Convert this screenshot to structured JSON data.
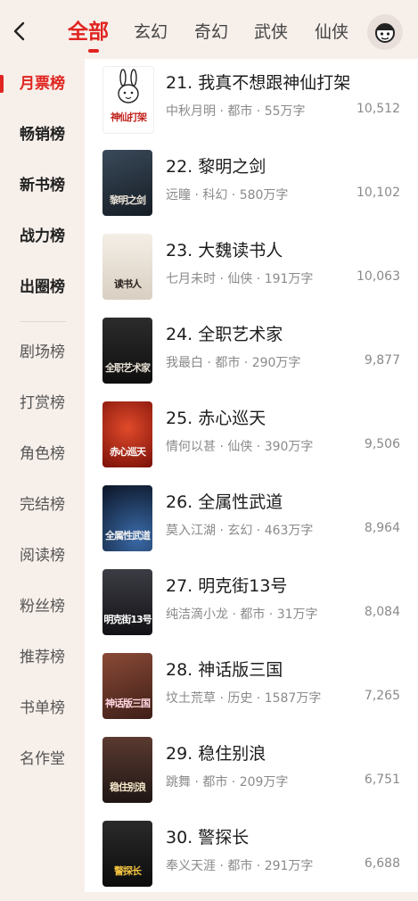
{
  "header": {
    "tabs": [
      {
        "label": "全部",
        "active": true
      },
      {
        "label": "玄幻",
        "active": false
      },
      {
        "label": "奇幻",
        "active": false
      },
      {
        "label": "武侠",
        "active": false
      },
      {
        "label": "仙侠",
        "active": false
      }
    ],
    "back_icon": "chevron-left-icon",
    "avatar_icon": "user-avatar-icon",
    "accent_color": "#e0241f"
  },
  "sidebar": {
    "items": [
      {
        "label": "月票榜",
        "active": true
      },
      {
        "label": "畅销榜"
      },
      {
        "label": "新书榜"
      },
      {
        "label": "战力榜"
      },
      {
        "label": "出圈榜"
      },
      {
        "label": "剧场榜"
      },
      {
        "label": "打赏榜"
      },
      {
        "label": "角色榜"
      },
      {
        "label": "完结榜"
      },
      {
        "label": "阅读榜"
      },
      {
        "label": "粉丝榜"
      },
      {
        "label": "推荐榜"
      },
      {
        "label": "书单榜"
      },
      {
        "label": "名作堂"
      }
    ]
  },
  "books": [
    {
      "title": "21. 我真不想跟神仙打架",
      "meta": "中秋月明 · 都市 · 55万字",
      "votes": "10,512",
      "cover_text": "神仙打架",
      "cover_color": "#ffffff",
      "cover_text_color": "#c0221b"
    },
    {
      "title": "22. 黎明之剑",
      "meta": "远瞳 · 科幻 · 580万字",
      "votes": "10,102",
      "cover_text": "黎明之剑",
      "cover_color": "#2b3440",
      "cover_text_color": "#e8e2d5"
    },
    {
      "title": "23. 大魏读书人",
      "meta": "七月未时 · 仙侠 · 191万字",
      "votes": "10,063",
      "cover_text": "读书人",
      "cover_color": "#efe9e0",
      "cover_text_color": "#2a2320"
    },
    {
      "title": "24. 全职艺术家",
      "meta": "我最白 · 都市 · 290万字",
      "votes": "9,877",
      "cover_text": "全职艺术家",
      "cover_color": "#1c1c1c",
      "cover_text_color": "#e6e0d5"
    },
    {
      "title": "25. 赤心巡天",
      "meta": "情何以甚 · 仙侠 · 390万字",
      "votes": "9,506",
      "cover_text": "赤心巡天",
      "cover_color": "#a52014",
      "cover_text_color": "#ffffff"
    },
    {
      "title": "26. 全属性武道",
      "meta": "莫入江湖 · 玄幻 · 463万字",
      "votes": "8,964",
      "cover_text": "全属性武道",
      "cover_color": "#14223a",
      "cover_text_color": "#f0f0f0"
    },
    {
      "title": "27. 明克街13号",
      "meta": "纯洁滴小龙 · 都市 · 31万字",
      "votes": "8,084",
      "cover_text": "明克街13号",
      "cover_color": "#2a2a30",
      "cover_text_color": "#ffffff"
    },
    {
      "title": "28. 神话版三国",
      "meta": "坟土荒草 · 历史 · 1587万字",
      "votes": "7,265",
      "cover_text": "神话版三国",
      "cover_color": "#6d3a2a",
      "cover_text_color": "#ffd6e0"
    },
    {
      "title": "29. 稳住别浪",
      "meta": "跳舞 · 都市 · 209万字",
      "votes": "6,751",
      "cover_text": "稳住别浪",
      "cover_color": "#3a2c2a",
      "cover_text_color": "#f4e6c8"
    },
    {
      "title": "30. 警探长",
      "meta": "奉义天涯 · 都市 · 291万字",
      "votes": "6,688",
      "cover_text": "警探长",
      "cover_color": "#1e1e1e",
      "cover_text_color": "#f0c040"
    }
  ]
}
